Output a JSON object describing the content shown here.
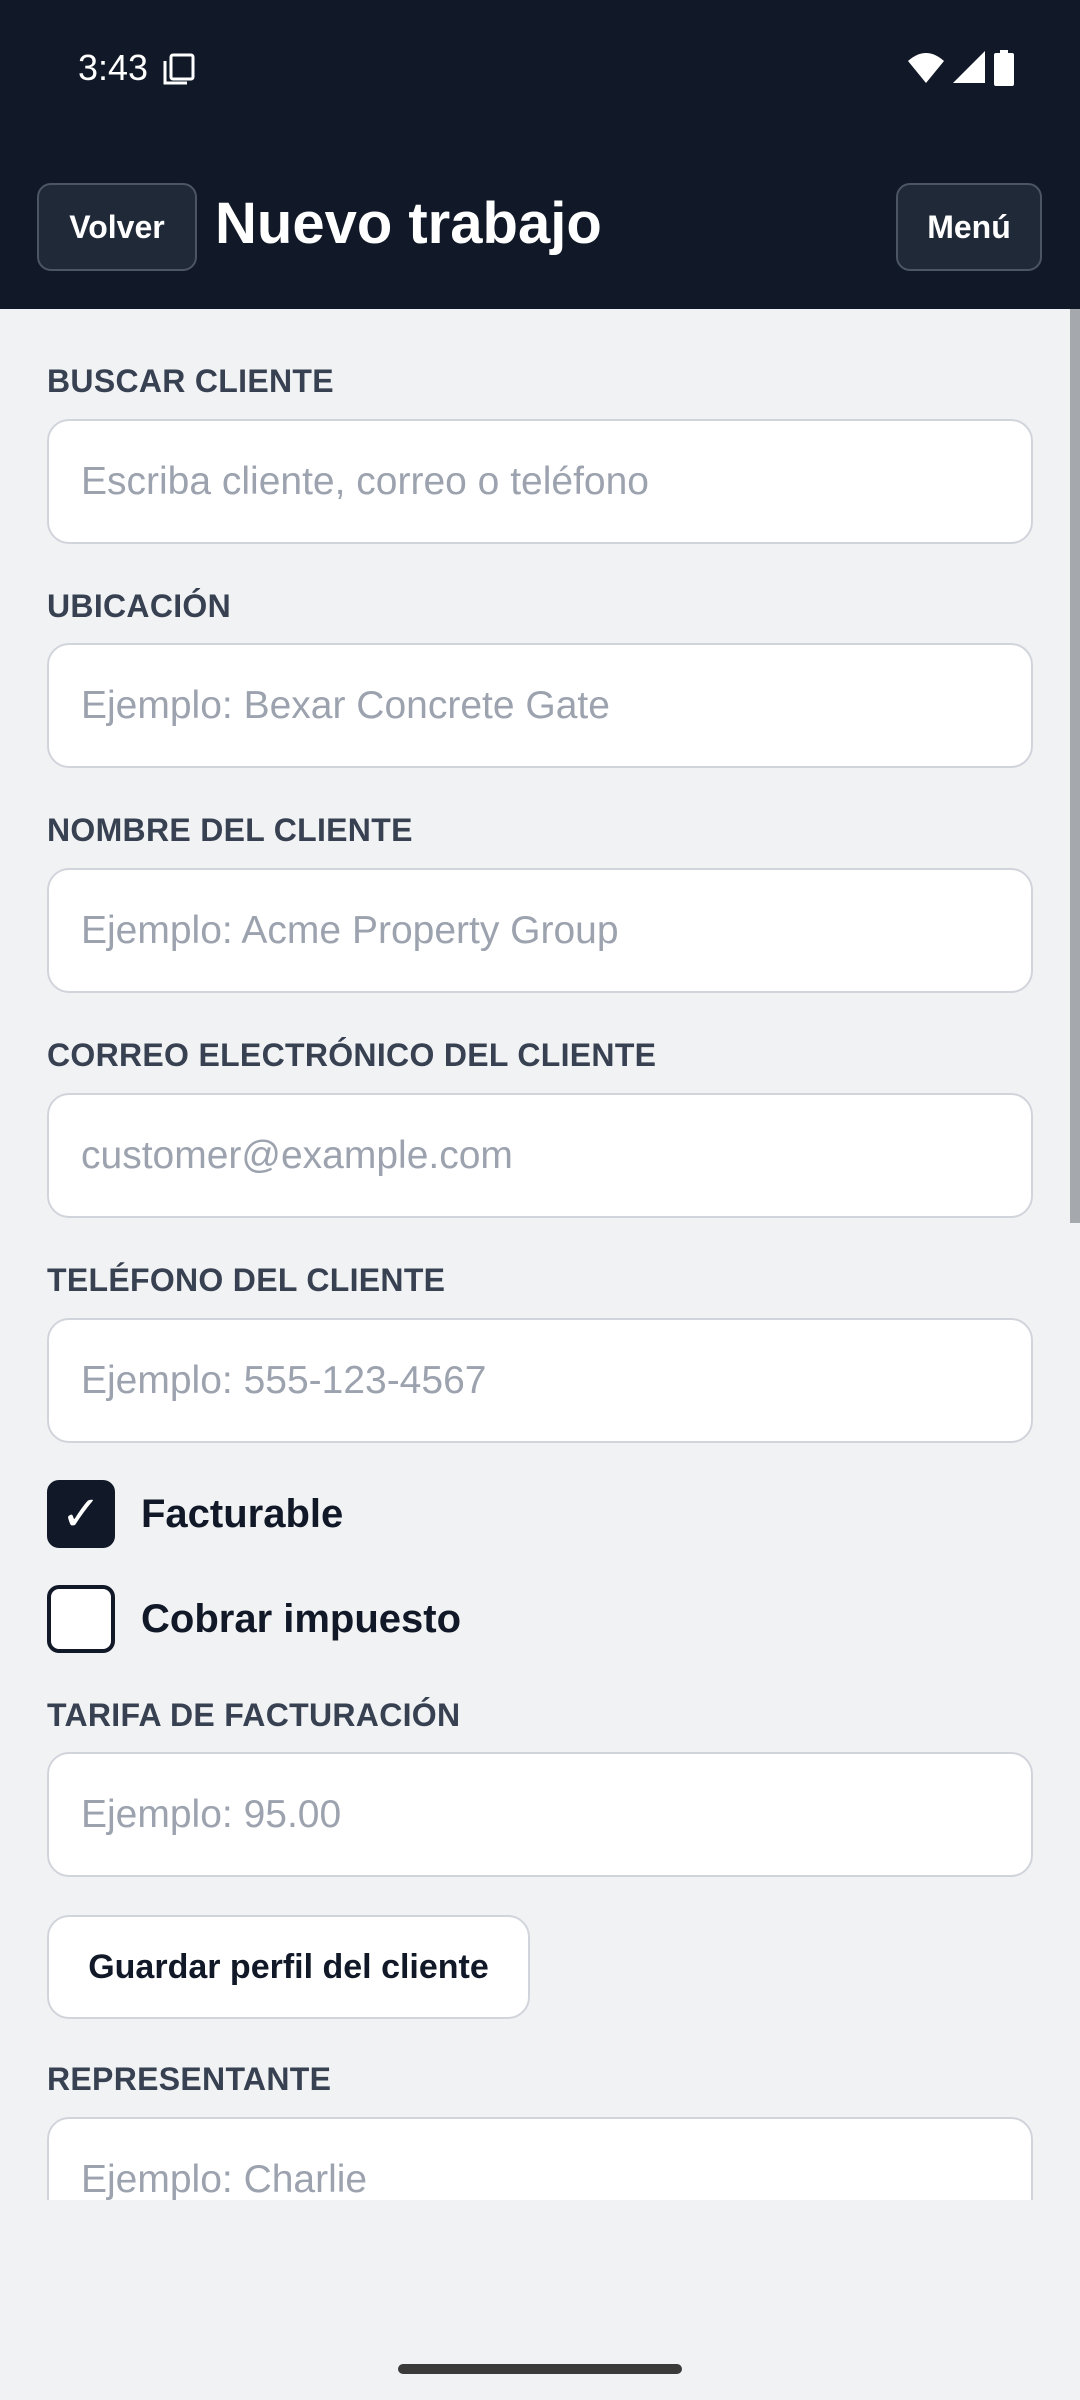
{
  "status_bar": {
    "time": "3:43"
  },
  "header": {
    "back_label": "Volver",
    "title": "Nuevo trabajo",
    "menu_label": "Menú"
  },
  "form": {
    "search": {
      "label": "BUSCAR CLIENTE",
      "placeholder": "Escriba cliente, correo o teléfono",
      "value": ""
    },
    "location": {
      "label": "UBICACIÓN",
      "placeholder": "Ejemplo: Bexar Concrete Gate",
      "value": ""
    },
    "customer_name": {
      "label": "NOMBRE DEL CLIENTE",
      "placeholder": "Ejemplo: Acme Property Group",
      "value": ""
    },
    "customer_email": {
      "label": "CORREO ELECTRÓNICO DEL CLIENTE",
      "placeholder": "customer@example.com",
      "value": ""
    },
    "customer_phone": {
      "label": "TELÉFONO DEL CLIENTE",
      "placeholder": "Ejemplo: 555-123-4567",
      "value": ""
    },
    "billable": {
      "label": "Facturable",
      "checked": true,
      "check_glyph": "✓"
    },
    "charge_tax": {
      "label": "Cobrar impuesto",
      "checked": false
    },
    "billing_rate": {
      "label": "TARIFA DE FACTURACIÓN",
      "placeholder": "Ejemplo: 95.00",
      "value": ""
    },
    "save_profile_label": "Guardar perfil del cliente",
    "representative": {
      "label": "REPRESENTANTE",
      "placeholder": "Ejemplo: Charlie",
      "value": ""
    }
  },
  "colors": {
    "header_bg": "#111827",
    "page_bg": "#f1f2f4",
    "label_text": "#374151",
    "placeholder_text": "#9ca3af",
    "input_border": "#d1d5db"
  }
}
